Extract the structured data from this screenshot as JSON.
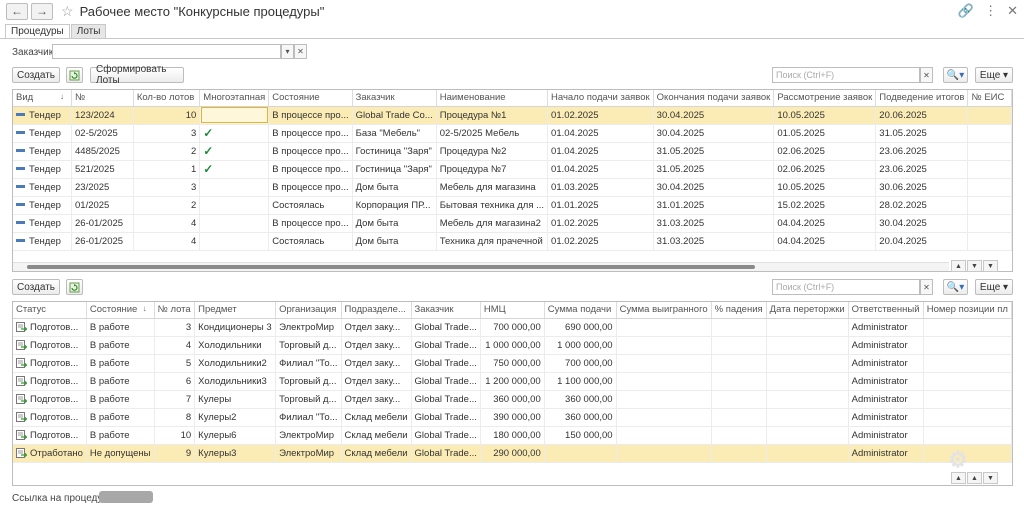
{
  "window": {
    "title": "Рабочее место \"Конкурсные процедуры\""
  },
  "tabs": [
    {
      "label": "Процедуры"
    },
    {
      "label": "Лоты"
    }
  ],
  "filter": {
    "label": "Заказчик:",
    "value": ""
  },
  "top_toolbar": {
    "create_label": "Создать",
    "form_lots_label": "Сформировать Лоты",
    "search_placeholder": "Поиск (Ctrl+F)",
    "more_label": "Еще"
  },
  "procedures": {
    "columns": [
      "Вид",
      "№",
      "Кол-во лотов",
      "Многоэтапная",
      "Состояние",
      "Заказчик",
      "Наименование",
      "Начало подачи заявок",
      "Окончания подачи заявок",
      "Рассмотрение заявок",
      "Подведение итогов",
      "№ ЕИС"
    ],
    "rows": [
      {
        "kind": "Тендер",
        "num": "123/2024",
        "lots": "10",
        "multi": false,
        "state": "В процессе про...",
        "customer": "Global Trade Co...",
        "name": "Процедура №1",
        "start": "01.02.2025",
        "end": "30.04.2025",
        "review": "10.05.2025",
        "result": "20.06.2025",
        "eis": "",
        "selected": true
      },
      {
        "kind": "Тендер",
        "num": "02-5/2025",
        "lots": "3",
        "multi": true,
        "state": "В процессе про...",
        "customer": "База \"Мебель\"",
        "name": "02-5/2025 Мебель",
        "start": "01.04.2025",
        "end": "30.04.2025",
        "review": "01.05.2025",
        "result": "31.05.2025",
        "eis": "",
        "selected": false
      },
      {
        "kind": "Тендер",
        "num": "4485/2025",
        "lots": "2",
        "multi": true,
        "state": "В процессе про...",
        "customer": "Гостиница \"Заря\"",
        "name": "Процедура №2",
        "start": "01.04.2025",
        "end": "31.05.2025",
        "review": "02.06.2025",
        "result": "23.06.2025",
        "eis": "",
        "selected": false
      },
      {
        "kind": "Тендер",
        "num": "521/2025",
        "lots": "1",
        "multi": true,
        "state": "В процессе про...",
        "customer": "Гостиница \"Заря\"",
        "name": "Процедура №7",
        "start": "01.04.2025",
        "end": "31.05.2025",
        "review": "02.06.2025",
        "result": "23.06.2025",
        "eis": "",
        "selected": false
      },
      {
        "kind": "Тендер",
        "num": "23/2025",
        "lots": "3",
        "multi": false,
        "state": "В процессе про...",
        "customer": "Дом быта",
        "name": "Мебель для магазина",
        "start": "01.03.2025",
        "end": "30.04.2025",
        "review": "10.05.2025",
        "result": "30.06.2025",
        "eis": "",
        "selected": false
      },
      {
        "kind": "Тендер",
        "num": "01/2025",
        "lots": "2",
        "multi": false,
        "state": "Состоялась",
        "customer": "Корпорация ПР...",
        "name": "Бытовая техника для ...",
        "start": "01.01.2025",
        "end": "31.01.2025",
        "review": "15.02.2025",
        "result": "28.02.2025",
        "eis": "",
        "selected": false
      },
      {
        "kind": "Тендер",
        "num": "26-01/2025",
        "lots": "4",
        "multi": false,
        "state": "В процессе про...",
        "customer": "Дом быта",
        "name": "Мебель для магазина2",
        "start": "01.02.2025",
        "end": "31.03.2025",
        "review": "04.04.2025",
        "result": "30.04.2025",
        "eis": "",
        "selected": false
      },
      {
        "kind": "Тендер",
        "num": "26-01/2025",
        "lots": "4",
        "multi": false,
        "state": "Состоялась",
        "customer": "Дом быта",
        "name": "Техника для прачечной",
        "start": "01.02.2025",
        "end": "31.03.2025",
        "review": "04.04.2025",
        "result": "20.04.2025",
        "eis": "",
        "selected": false
      }
    ]
  },
  "bottom_toolbar": {
    "create_label": "Создать",
    "search_placeholder": "Поиск (Ctrl+F)",
    "more_label": "Еще"
  },
  "lots": {
    "columns": [
      "Статус",
      "Состояние",
      "№ лота",
      "Предмет",
      "Организация",
      "Подразделе...",
      "Заказчик",
      "НМЦ",
      "Сумма подачи",
      "Сумма выигранного",
      "% падения",
      "Дата переторжки",
      "Ответственный",
      "Номер позиции пл"
    ],
    "rows": [
      {
        "status": "Подготов...",
        "state": "В работе",
        "lot": "3",
        "subject": "Кондиционеры 3",
        "org": "ЭлектроМир",
        "dept": "Отдел заку...",
        "customer": "Global Trade...",
        "nmc": "700 000,00",
        "sum": "690 000,00",
        "won": "",
        "drop": "",
        "date": "",
        "resp": "Administrator",
        "pos": "",
        "selected": false
      },
      {
        "status": "Подготов...",
        "state": "В работе",
        "lot": "4",
        "subject": "Холодильники",
        "org": "Торговый д...",
        "dept": "Отдел заку...",
        "customer": "Global Trade...",
        "nmc": "1 000 000,00",
        "sum": "1 000 000,00",
        "won": "",
        "drop": "",
        "date": "",
        "resp": "Administrator",
        "pos": "",
        "selected": false
      },
      {
        "status": "Подготов...",
        "state": "В работе",
        "lot": "5",
        "subject": "Холодильники2",
        "org": "Филиал \"То...",
        "dept": "Отдел заку...",
        "customer": "Global Trade...",
        "nmc": "750 000,00",
        "sum": "700 000,00",
        "won": "",
        "drop": "",
        "date": "",
        "resp": "Administrator",
        "pos": "",
        "selected": false
      },
      {
        "status": "Подготов...",
        "state": "В работе",
        "lot": "6",
        "subject": "Холодильники3",
        "org": "Торговый д...",
        "dept": "Отдел заку...",
        "customer": "Global Trade...",
        "nmc": "1 200 000,00",
        "sum": "1 100 000,00",
        "won": "",
        "drop": "",
        "date": "",
        "resp": "Administrator",
        "pos": "",
        "selected": false
      },
      {
        "status": "Подготов...",
        "state": "В работе",
        "lot": "7",
        "subject": "Кулеры",
        "org": "Торговый д...",
        "dept": "Отдел заку...",
        "customer": "Global Trade...",
        "nmc": "360 000,00",
        "sum": "360 000,00",
        "won": "",
        "drop": "",
        "date": "",
        "resp": "Administrator",
        "pos": "",
        "selected": false
      },
      {
        "status": "Подготов...",
        "state": "В работе",
        "lot": "8",
        "subject": "Кулеры2",
        "org": "Филиал \"То...",
        "dept": "Склад мебели",
        "customer": "Global Trade...",
        "nmc": "390 000,00",
        "sum": "360 000,00",
        "won": "",
        "drop": "",
        "date": "",
        "resp": "Administrator",
        "pos": "",
        "selected": false
      },
      {
        "status": "Подготов...",
        "state": "В работе",
        "lot": "10",
        "subject": "Кулеры6",
        "org": "ЭлектроМир",
        "dept": "Склад мебели",
        "customer": "Global Trade...",
        "nmc": "180 000,00",
        "sum": "150 000,00",
        "won": "",
        "drop": "",
        "date": "",
        "resp": "Administrator",
        "pos": "",
        "selected": false
      },
      {
        "status": "Отработано",
        "state": "Не допущены",
        "lot": "9",
        "subject": "Кулеры3",
        "org": "ЭлектроМир",
        "dept": "Склад мебели",
        "customer": "Global Trade...",
        "nmc": "290 000,00",
        "sum": "",
        "won": "",
        "drop": "",
        "date": "",
        "resp": "Administrator",
        "pos": "",
        "selected": true
      }
    ]
  },
  "footer": {
    "link_label": "Ссылка на процедуру:"
  }
}
